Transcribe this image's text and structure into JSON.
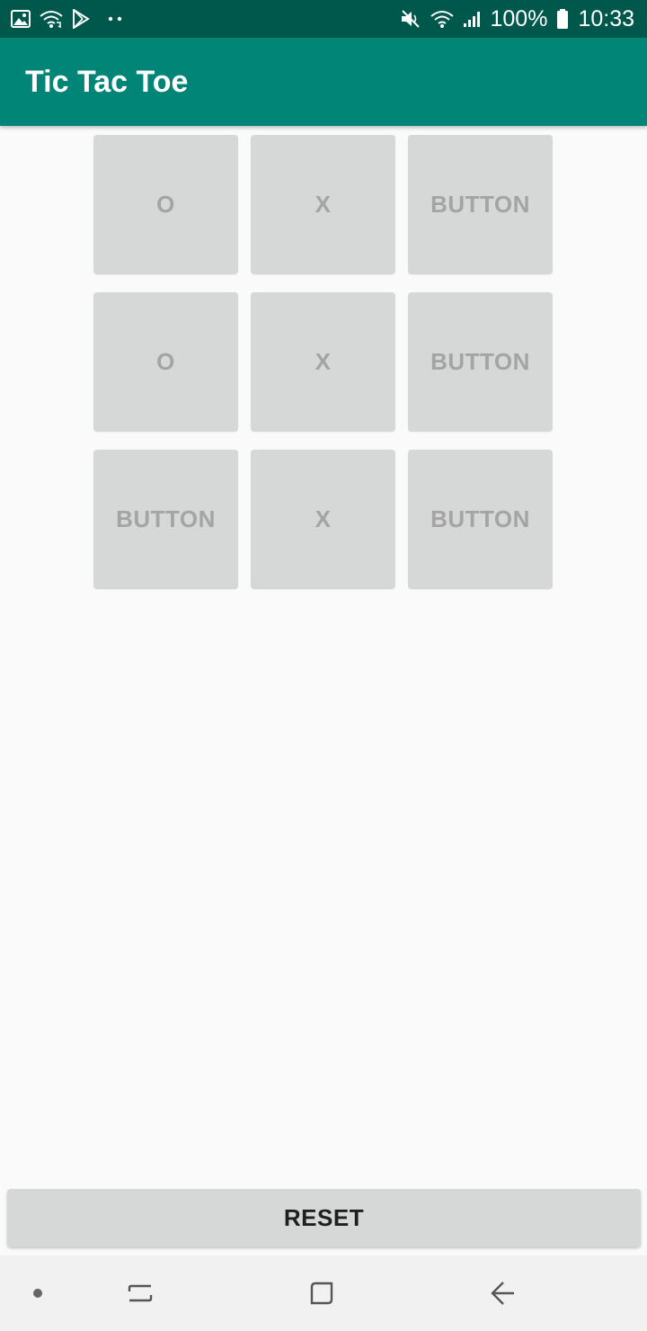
{
  "status_bar": {
    "left_icons": [
      "gallery-icon",
      "wifi-calling-icon",
      "play-store-icon",
      "more-dots-icon"
    ],
    "right_icons": [
      "mute-icon",
      "wifi-icon",
      "signal-icon",
      "battery-icon"
    ],
    "battery_text": "100%",
    "time": "10:33"
  },
  "app_bar": {
    "title": "Tic Tac Toe",
    "color": "#008577"
  },
  "board": {
    "rows": [
      [
        "O",
        "X",
        "BUTTON"
      ],
      [
        "O",
        "X",
        "BUTTON"
      ],
      [
        "BUTTON",
        "X",
        "BUTTON"
      ]
    ]
  },
  "reset_button": {
    "label": "RESET"
  },
  "nav_bar": {
    "items": [
      "dot-icon",
      "recents-icon",
      "home-icon",
      "back-icon"
    ]
  }
}
